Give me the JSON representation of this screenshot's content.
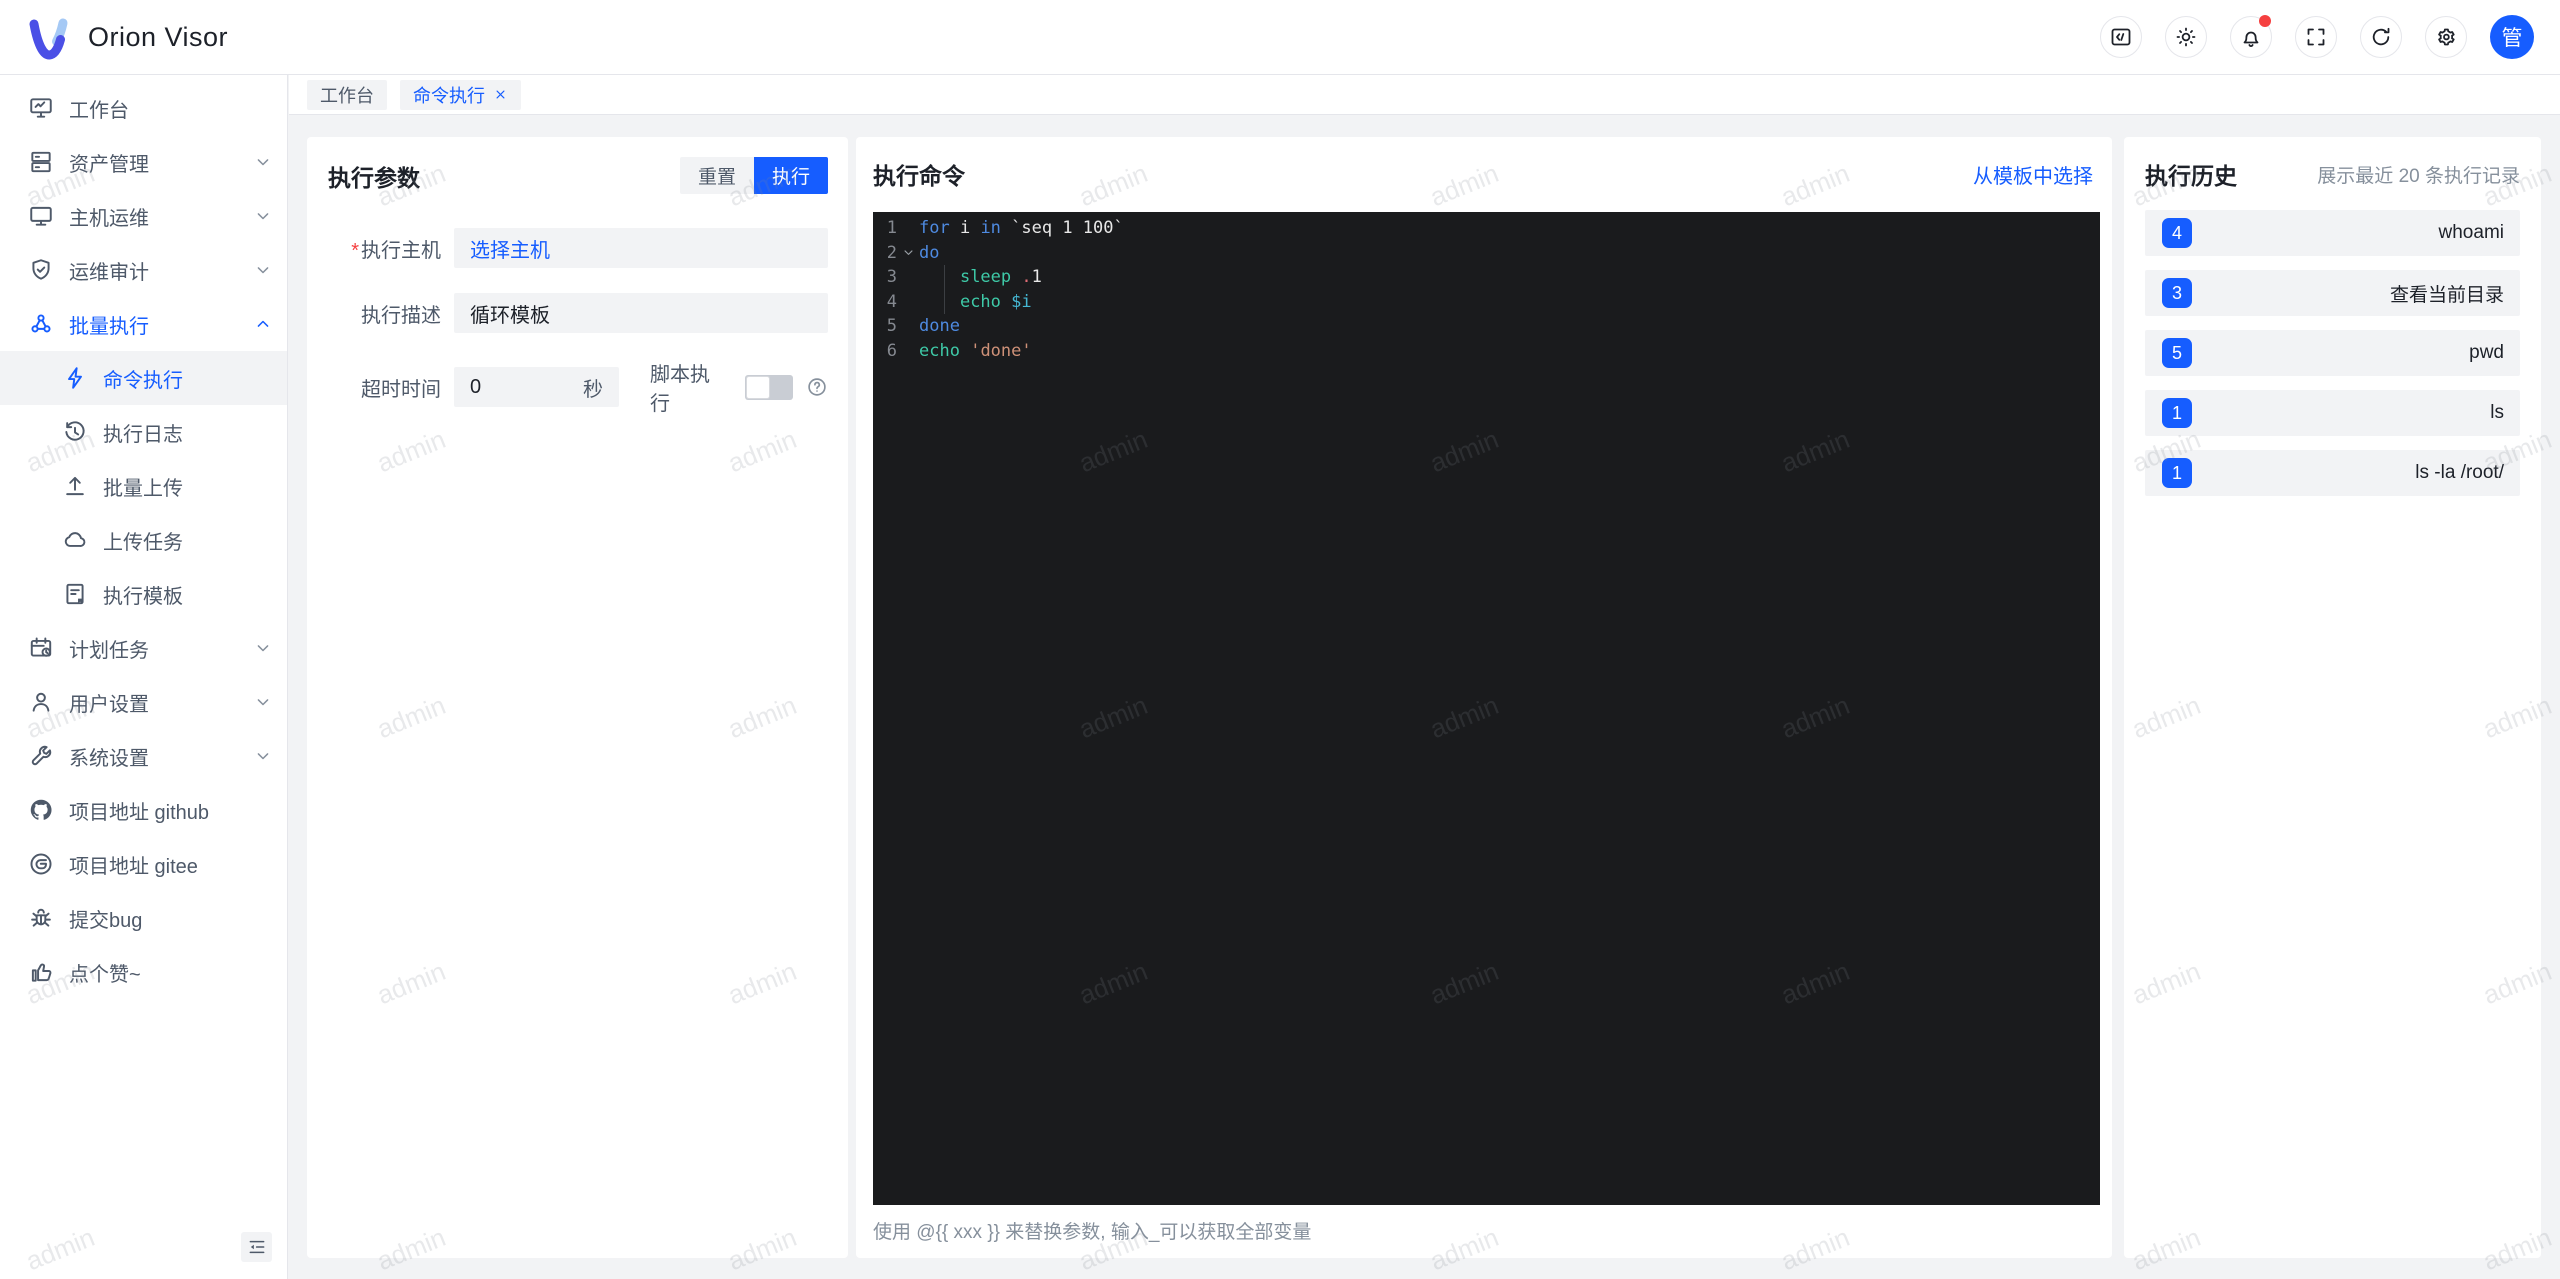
{
  "colors": {
    "primary": "#165dff",
    "danger": "#f53f3f",
    "editor_bg": "#1a1b1d",
    "page_bg": "#f2f3f5",
    "border": "#e5e6eb"
  },
  "app": {
    "title": "Orion Visor"
  },
  "header": {
    "actions": [
      {
        "name": "code-block-icon",
        "icon": "code"
      },
      {
        "name": "theme-light-icon",
        "icon": "sun"
      },
      {
        "name": "notifications-icon",
        "icon": "bell",
        "badge": true
      },
      {
        "name": "fullscreen-icon",
        "icon": "fullscreen"
      },
      {
        "name": "refresh-icon",
        "icon": "refresh"
      },
      {
        "name": "settings-icon",
        "icon": "gear"
      }
    ],
    "avatar_text": "管"
  },
  "sidebar": {
    "items": [
      {
        "id": "workbench",
        "label": "工作台",
        "icon": "monitor"
      },
      {
        "id": "assets",
        "label": "资产管理",
        "icon": "server",
        "chevron": "down"
      },
      {
        "id": "host-ops",
        "label": "主机运维",
        "icon": "desktop",
        "chevron": "down"
      },
      {
        "id": "audit",
        "label": "运维审计",
        "icon": "shield",
        "chevron": "down"
      },
      {
        "id": "batch-exec",
        "label": "批量执行",
        "icon": "cluster",
        "chevron": "up",
        "parentActive": true
      },
      {
        "id": "cmd-exec",
        "label": "命令执行",
        "icon": "bolt",
        "sub": true,
        "selected": true
      },
      {
        "id": "exec-log",
        "label": "执行日志",
        "icon": "history",
        "sub": true
      },
      {
        "id": "batch-upload",
        "label": "批量上传",
        "icon": "upload",
        "sub": true
      },
      {
        "id": "upload-task",
        "label": "上传任务",
        "icon": "cloud",
        "sub": true
      },
      {
        "id": "exec-template",
        "label": "执行模板",
        "icon": "template",
        "sub": true
      },
      {
        "id": "schedule",
        "label": "计划任务",
        "icon": "calendar",
        "chevron": "down"
      },
      {
        "id": "user-settings",
        "label": "用户设置",
        "icon": "user",
        "chevron": "down"
      },
      {
        "id": "system-settings",
        "label": "系统设置",
        "icon": "wrench",
        "chevron": "down"
      },
      {
        "id": "github",
        "label": "项目地址 github",
        "icon": "github"
      },
      {
        "id": "gitee",
        "label": "项目地址 gitee",
        "icon": "gitee"
      },
      {
        "id": "bug",
        "label": "提交bug",
        "icon": "bug"
      },
      {
        "id": "like",
        "label": "点个赞~",
        "icon": "like"
      }
    ]
  },
  "tabs": [
    {
      "label": "工作台",
      "active": false,
      "closable": false
    },
    {
      "label": "命令执行",
      "active": true,
      "closable": true
    }
  ],
  "params_panel": {
    "title": "执行参数",
    "reset_label": "重置",
    "run_label": "执行",
    "host_label": "执行主机",
    "host_value": "选择主机",
    "desc_label": "执行描述",
    "desc_value": "循环模板",
    "timeout_label": "超时时间",
    "timeout_value": "0",
    "timeout_suffix": "秒",
    "script_label": "脚本执行",
    "script_enabled": false
  },
  "command_panel": {
    "title": "执行命令",
    "template_link": "从模板中选择",
    "hint": "使用 @{{ xxx }} 来替换参数, 输入_可以获取全部变量",
    "code_lines": [
      {
        "num": 1,
        "tokens": [
          {
            "t": "kw",
            "v": "for"
          },
          {
            "t": "pl",
            "v": " i "
          },
          {
            "t": "kw",
            "v": "in"
          },
          {
            "t": "pl",
            "v": " `seq 1 100`"
          }
        ]
      },
      {
        "num": 2,
        "fold": "open",
        "tokens": [
          {
            "t": "kw",
            "v": "do"
          }
        ]
      },
      {
        "num": 3,
        "guide": true,
        "tokens": [
          {
            "t": "pl",
            "v": "    "
          },
          {
            "t": "fn",
            "v": "sleep"
          },
          {
            "t": "pl",
            "v": " "
          },
          {
            "t": "dot",
            "v": "."
          },
          {
            "t": "pl",
            "v": "1"
          }
        ]
      },
      {
        "num": 4,
        "guide": true,
        "tokens": [
          {
            "t": "pl",
            "v": "    "
          },
          {
            "t": "fn",
            "v": "echo"
          },
          {
            "t": "pl",
            "v": " "
          },
          {
            "t": "var",
            "v": "$i"
          }
        ]
      },
      {
        "num": 5,
        "tokens": [
          {
            "t": "kw",
            "v": "done"
          }
        ]
      },
      {
        "num": 6,
        "tokens": [
          {
            "t": "fn",
            "v": "echo"
          },
          {
            "t": "pl",
            "v": " "
          },
          {
            "t": "str",
            "v": "'done'"
          }
        ]
      }
    ]
  },
  "history_panel": {
    "title": "执行历史",
    "subtitle": "展示最近 20 条执行记录",
    "items": [
      {
        "count": "4",
        "command": "whoami"
      },
      {
        "count": "3",
        "command": "查看当前目录"
      },
      {
        "count": "5",
        "command": "pwd"
      },
      {
        "count": "1",
        "command": "ls"
      },
      {
        "count": "1",
        "command": "ls -la /root/"
      }
    ]
  },
  "watermark": "admin"
}
